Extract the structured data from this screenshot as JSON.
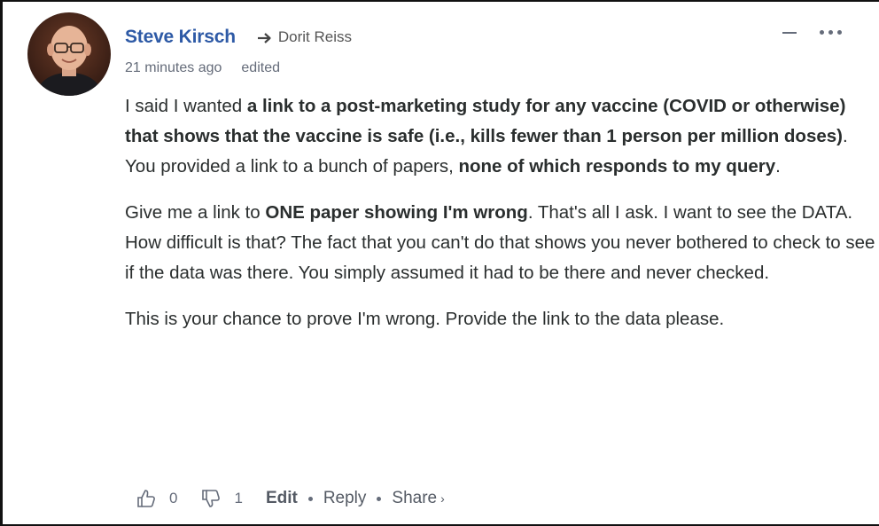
{
  "comment": {
    "author": "Steve Kirsch",
    "reply_to": "Dorit Reiss",
    "timestamp": "21 minutes ago",
    "edited": "edited",
    "paragraphs": [
      [
        {
          "text": "I said I wanted ",
          "bold": false
        },
        {
          "text": "a link to a post-marketing study for any vaccine (COVID or otherwise) that shows that the vaccine is safe (i.e., kills fewer than 1 person per million doses)",
          "bold": true
        },
        {
          "text": ". You provided a link to a bunch of papers, ",
          "bold": false
        },
        {
          "text": "none of which responds to my query",
          "bold": true
        },
        {
          "text": ".",
          "bold": false
        }
      ],
      [
        {
          "text": "Give me a link to ",
          "bold": false
        },
        {
          "text": "ONE paper showing I'm wrong",
          "bold": true
        },
        {
          "text": ". That's all I ask. I want to see the DATA. How difficult is that? The fact that you can't do that shows you never bothered to check to see if the data was there. You simply assumed it had to be there and never checked.",
          "bold": false
        }
      ],
      [
        {
          "text": "This is your chance to prove I'm wrong. Provide the link to the data please.",
          "bold": false
        }
      ]
    ]
  },
  "footer": {
    "upvotes": "0",
    "downvotes": "1",
    "edit_label": "Edit",
    "reply_label": "Reply",
    "share_label": "Share",
    "share_chevron": "›"
  },
  "icons": {
    "reply_arrow": "arrow-right-icon",
    "collapse": "minus-icon",
    "more": "ellipsis-icon",
    "upvote": "thumbs-up-icon",
    "downvote": "thumbs-down-icon"
  },
  "colors": {
    "author": "#2e5aa6",
    "text": "#2a2e2e",
    "muted": "#656c7a"
  }
}
